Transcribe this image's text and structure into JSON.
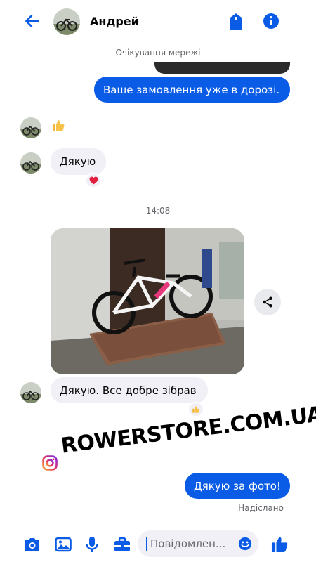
{
  "header": {
    "contact_name": "Андрей"
  },
  "status": {
    "network": "Очікування мережі"
  },
  "messages": {
    "outgoing_1": "Ваше замовлення уже в дорозі.",
    "incoming_thanks": "Дякую",
    "timestamp": "14:08",
    "incoming_2": "Дякую. Все добре зібрав",
    "outgoing_2": "Дякую за фото!",
    "sent_status": "Надіслано"
  },
  "watermark": {
    "text": "ROWERSTORE.COM.UA"
  },
  "composer": {
    "placeholder": "Повідомлен..."
  },
  "colors": {
    "accent": "#0a5ce6",
    "bubble_in": "#f0f0f6",
    "secondary_text": "#65676b"
  },
  "icons": [
    "back-arrow-icon",
    "tag-icon",
    "info-icon",
    "thumbs-up-icon",
    "heart-icon",
    "share-icon",
    "camera-icon",
    "gallery-icon",
    "microphone-icon",
    "briefcase-icon",
    "emoji-icon",
    "instagram-icon"
  ]
}
